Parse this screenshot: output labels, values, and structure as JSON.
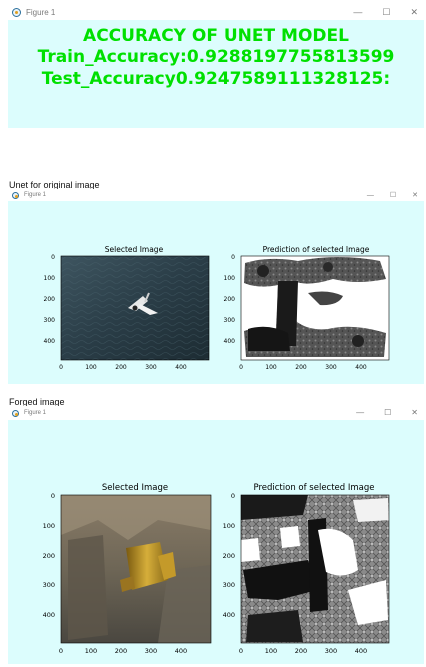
{
  "window1": {
    "title": "Figure 1",
    "controls": {
      "minimize": "—",
      "maximize": "☐",
      "close": "✕"
    },
    "lines": [
      "ACCURACY OF UNET MODEL",
      "Train_Accuracy:0.9288197755813599",
      "Test_Accuracy0.9247589111328125:"
    ],
    "text_color": "#00e000",
    "background": "#dcfdfd"
  },
  "caption1": "Unet for original image",
  "window2": {
    "title": "Figure 1",
    "controls": {
      "minimize": "—",
      "maximize": "☐",
      "close": "✕"
    },
    "left_plot": {
      "title": "Selected Image",
      "xticks": [
        "0",
        "100",
        "200",
        "300",
        "400"
      ],
      "yticks": [
        "0",
        "100",
        "200",
        "300",
        "400"
      ],
      "image": "bird-flying-over-water"
    },
    "right_plot": {
      "title": "Prediction of selected Image",
      "xticks": [
        "0",
        "100",
        "200",
        "300",
        "400"
      ],
      "yticks": [
        "0",
        "100",
        "200",
        "300",
        "400"
      ],
      "image": "prediction-mask"
    }
  },
  "caption2": "Forged image",
  "window3": {
    "title": "Figure 1",
    "controls": {
      "minimize": "—",
      "maximize": "☐",
      "close": "✕"
    },
    "left_plot": {
      "title": "Selected Image",
      "xticks": [
        "0",
        "100",
        "200",
        "300",
        "400"
      ],
      "yticks": [
        "0",
        "100",
        "200",
        "300",
        "400"
      ],
      "image": "forged-building-with-gold-object"
    },
    "right_plot": {
      "title": "Prediction of selected Image",
      "xticks": [
        "0",
        "100",
        "200",
        "300",
        "400"
      ],
      "yticks": [
        "0",
        "100",
        "200",
        "300",
        "400"
      ],
      "image": "prediction-mask"
    }
  }
}
